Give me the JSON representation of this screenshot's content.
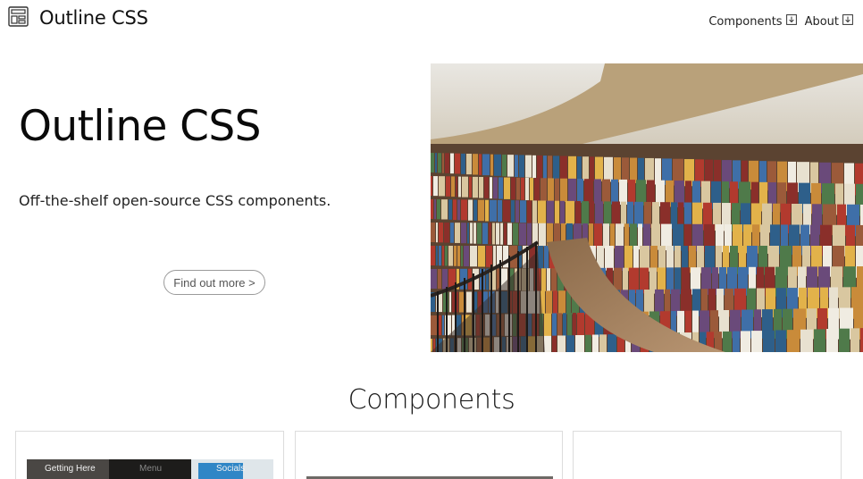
{
  "header": {
    "brand": {
      "icon": "layout-icon",
      "name": "Outline CSS"
    },
    "nav": [
      {
        "label": "Components",
        "icon": "arrow-down-box-icon"
      },
      {
        "label": "About",
        "icon": "arrow-down-box-icon"
      }
    ]
  },
  "hero": {
    "title": "Outline CSS",
    "subtitle": "Off-the-shelf open-source CSS components.",
    "cta_label": "Find out more >"
  },
  "components": {
    "title": "Components",
    "cards": [
      {
        "thumb_labels": [
          "Getting Here",
          "Menu",
          "Socials"
        ]
      },
      {
        "thumb_labels": []
      },
      {
        "thumb_labels": []
      }
    ]
  }
}
